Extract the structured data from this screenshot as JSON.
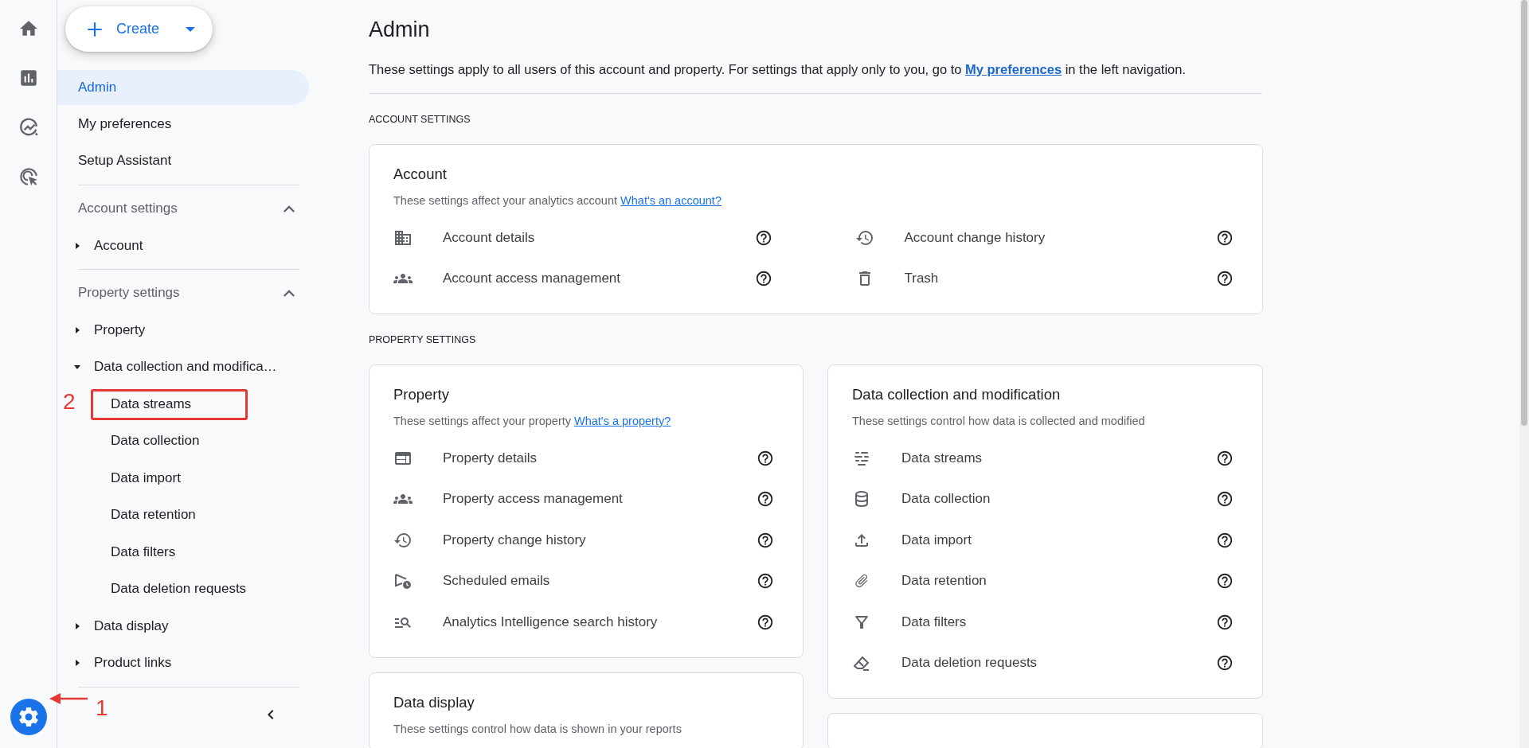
{
  "rail": {
    "items": [
      {
        "selected": false
      },
      {
        "selected": false
      },
      {
        "selected": false
      },
      {
        "selected": false
      }
    ],
    "settings": {
      "selected": true
    }
  },
  "nav": {
    "create": "Create",
    "items": [
      {
        "label": "Admin",
        "selected": true
      },
      {
        "label": "My preferences",
        "selected": false
      },
      {
        "label": "Setup Assistant",
        "selected": false
      }
    ],
    "sections": [
      {
        "title": "Account settings",
        "expanded": true,
        "items": [
          {
            "label": "Account",
            "expanded": false
          }
        ]
      },
      {
        "title": "Property settings",
        "expanded": true,
        "items": [
          {
            "label": "Property",
            "expanded": false
          },
          {
            "label": "Data collection and modifica…",
            "expanded": true,
            "children": [
              {
                "label": "Data streams"
              },
              {
                "label": "Data collection"
              },
              {
                "label": "Data import"
              },
              {
                "label": "Data retention"
              },
              {
                "label": "Data filters"
              },
              {
                "label": "Data deletion requests"
              }
            ]
          },
          {
            "label": "Data display",
            "expanded": false
          },
          {
            "label": "Product links",
            "expanded": false
          }
        ]
      }
    ]
  },
  "annotations": [
    {
      "kind": "arrow",
      "label": "1"
    },
    {
      "kind": "box",
      "label": "2"
    }
  ],
  "main": {
    "title": "Admin",
    "description": {
      "before": "These settings apply to all users of this account and property. For settings that apply only to you, go to ",
      "link": "My preferences",
      "after": " in the left navigation."
    },
    "sections": [
      {
        "heading": "ACCOUNT SETTINGS",
        "cards": [
          {
            "title": "Account",
            "description": "These settings affect your analytics account",
            "link": "What's an account?",
            "items": [
              "Account details",
              "Account change history",
              "Account access management",
              "Trash"
            ]
          }
        ]
      },
      {
        "heading": "PROPERTY SETTINGS",
        "cards": [
          {
            "title": "Property",
            "description": "These settings affect your property",
            "link": "What's a property?",
            "items": [
              "Property details",
              "Property access management",
              "Property change history",
              "Scheduled emails",
              "Analytics Intelligence search history"
            ]
          },
          {
            "title": "Data collection and modification",
            "description": "These settings control how data is collected and modified",
            "items": [
              "Data streams",
              "Data collection",
              "Data import",
              "Data retention",
              "Data filters",
              "Data deletion requests"
            ]
          },
          {
            "title": "Data display",
            "description": "These settings control how data is shown in your reports"
          }
        ]
      }
    ]
  }
}
